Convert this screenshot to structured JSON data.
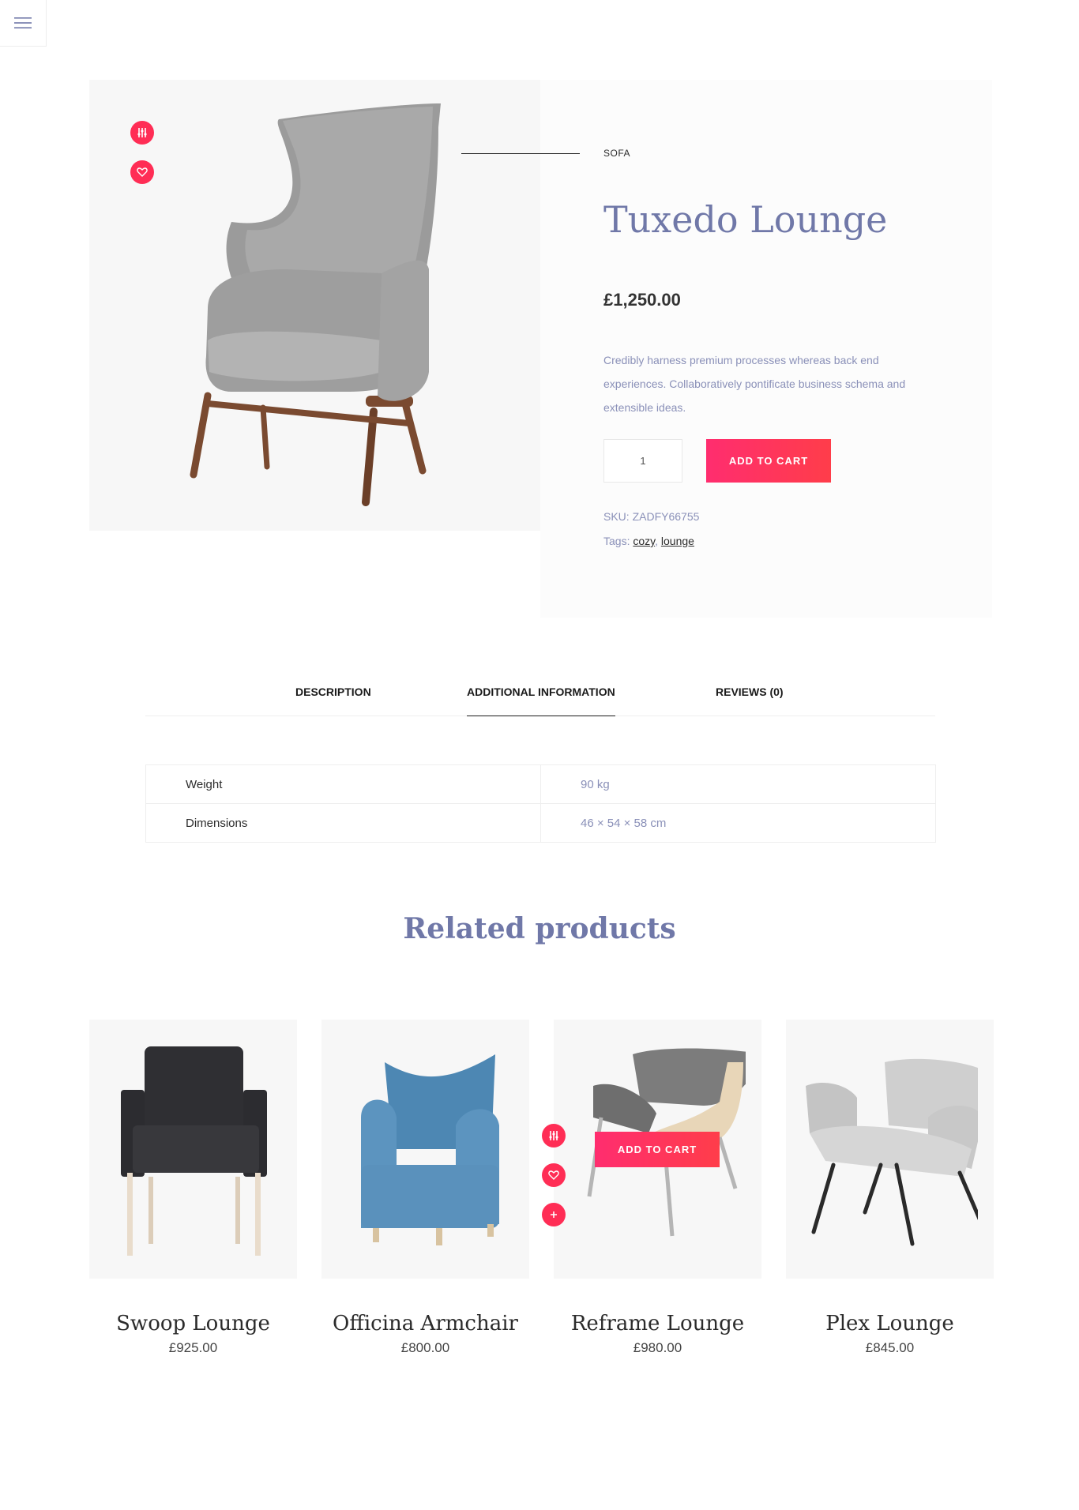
{
  "product": {
    "category": "SOFA",
    "title": "Tuxedo Lounge",
    "price": "£1,250.00",
    "description": "Credibly harness premium processes whereas back end experiences. Collaboratively pontificate business schema and extensible ideas.",
    "quantity": "1",
    "add_to_cart_label": "ADD TO CART",
    "sku_label": "SKU:",
    "sku": "ZADFY66755",
    "tags_label": "Tags:",
    "tags": [
      "cozy",
      "lounge"
    ],
    "tag_separator": ","
  },
  "tabs": [
    {
      "label": "DESCRIPTION",
      "active": false
    },
    {
      "label": "ADDITIONAL INFORMATION",
      "active": true
    },
    {
      "label": "REVIEWS (0)",
      "active": false
    }
  ],
  "additional_info": [
    {
      "key": "Weight",
      "value": "90 kg"
    },
    {
      "key": "Dimensions",
      "value": "46 × 54 × 58 cm"
    }
  ],
  "related": {
    "title": "Related products",
    "add_to_cart_label": "ADD TO CART",
    "items": [
      {
        "name": "Swoop Lounge",
        "price": "£925.00"
      },
      {
        "name": "Officina Armchair",
        "price": "£800.00"
      },
      {
        "name": "Reframe Lounge",
        "price": "£980.00"
      },
      {
        "name": "Plex Lounge",
        "price": "£845.00"
      }
    ]
  },
  "colors": {
    "accent": "#ff2d55",
    "heading": "#7078a8",
    "muted_text": "#8a90b8"
  },
  "icons": {
    "menu": "hamburger-icon",
    "compare": "compare-icon",
    "wishlist": "heart-icon",
    "quick_add": "plus-icon"
  }
}
